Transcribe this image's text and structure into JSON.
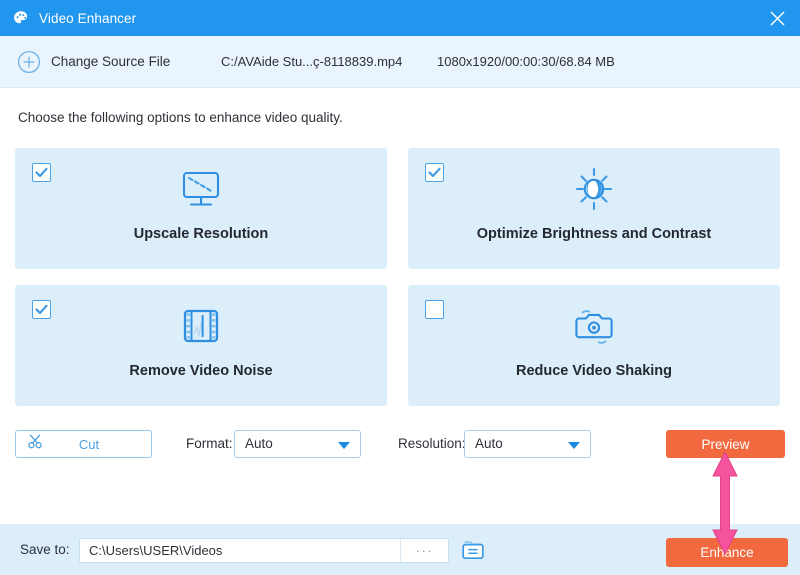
{
  "window": {
    "title": "Video Enhancer",
    "title_icon": "palette-icon",
    "close_icon": "close-icon",
    "accent_blue": "#2196ef",
    "accent_orange": "#f2683f",
    "annotation_pink": "#f6539e"
  },
  "source_bar": {
    "add_icon": "plus-circle-icon",
    "change_source_label": "Change Source File",
    "file_path": "C:/AVAide Stu...ç-8118839.mp4",
    "file_meta": "1080x1920/00:00:30/68.84 MB"
  },
  "instruction": "Choose the following options to enhance video quality.",
  "options": [
    {
      "label": "Upscale Resolution",
      "icon": "monitor-upscale-icon",
      "checked": true
    },
    {
      "label": "Optimize Brightness and Contrast",
      "icon": "sun-brightness-icon",
      "checked": true
    },
    {
      "label": "Remove Video Noise",
      "icon": "film-strip-icon",
      "checked": true
    },
    {
      "label": "Reduce Video Shaking",
      "icon": "camera-shake-icon",
      "checked": false
    }
  ],
  "controls": {
    "cut_label": "Cut",
    "cut_icon": "scissors-icon",
    "format_label": "Format:",
    "format_value": "Auto",
    "resolution_label": "Resolution:",
    "resolution_value": "Auto",
    "preview_label": "Preview"
  },
  "bottom": {
    "save_to_label": "Save to:",
    "save_path": "C:\\Users\\USER\\Videos",
    "browse_dots": "···",
    "folder_icon": "open-folder-icon",
    "enhance_label": "Enhance"
  }
}
